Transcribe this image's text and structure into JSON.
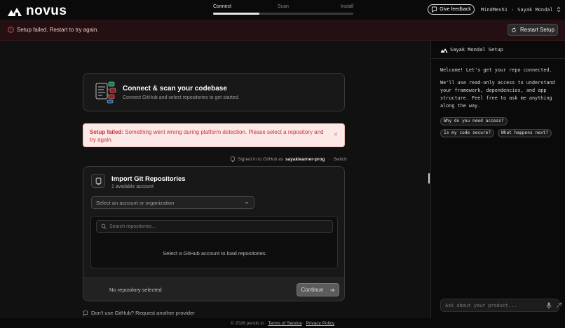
{
  "app": {
    "name": "novus"
  },
  "steps": {
    "items": [
      {
        "label": "Connect",
        "active": true
      },
      {
        "label": "Scan",
        "active": false
      },
      {
        "label": "Install",
        "active": false
      }
    ],
    "progress": 0.33
  },
  "topbar": {
    "feedback_label": "Give feedback",
    "breadcrumb": {
      "workspace": "MindMesh1",
      "separator": "›",
      "user": "Sayak Mondal"
    }
  },
  "banner": {
    "message": "Setup failed. Restart to try again.",
    "restart_label": "Restart Setup"
  },
  "connect_card": {
    "title": "Connect & scan your codebase",
    "subtitle": "Connect GitHub and select repositories to get started."
  },
  "alert": {
    "prefix": "Setup failed:",
    "message": "Something went wrong during platform detection. Please select a repository and try again.",
    "close_glyph": "×"
  },
  "signed_in": {
    "prefix": "Signed in to GitHub as",
    "username": "sayaklearner-prog",
    "separator": "·",
    "switch_label": "Switch"
  },
  "import_card": {
    "title": "Import Git Repositories",
    "subtitle": "1 available account",
    "account_placeholder": "Select an account or organization",
    "search_placeholder": "Search repositories...",
    "empty_message": "Select a GitHub account to load repositories.",
    "no_selection": "No repository selected",
    "continue_label": "Continue"
  },
  "alt_provider": {
    "label": "Don't use GitHub? Request another provider"
  },
  "footer": {
    "copyright": "© 2026 pendo.io",
    "separator": "·",
    "terms": "Terms of Service",
    "privacy": "Privacy Policy"
  },
  "chat": {
    "title": "Sayak Mondal Setup",
    "messages": [
      "Welcome! Let's get your repo connected.",
      "We'll use read-only access to understand your framework, dependencies, and app structure. Feel free to ask me anything along the way."
    ],
    "chips": [
      "Why do you need access?",
      "Is my code secure?",
      "What happens next?"
    ],
    "input_placeholder": "Ask about your product..."
  },
  "colors": {
    "background": "#111111",
    "banner_bg": "#241012",
    "alert_bg": "#fde8e8",
    "alert_text": "#c23a3a",
    "accent": "#e8e8e8"
  },
  "icons": {
    "logo": "novus-logo-icon",
    "feedback": "chat-bubble-icon",
    "banner": "alert-circle-icon",
    "restart": "refresh-icon",
    "repo": "repository-icon",
    "search": "search-icon",
    "chevron": "chevron-down-icon",
    "continue": "arrow-right-icon",
    "mic": "microphone-icon",
    "send": "send-icon"
  }
}
